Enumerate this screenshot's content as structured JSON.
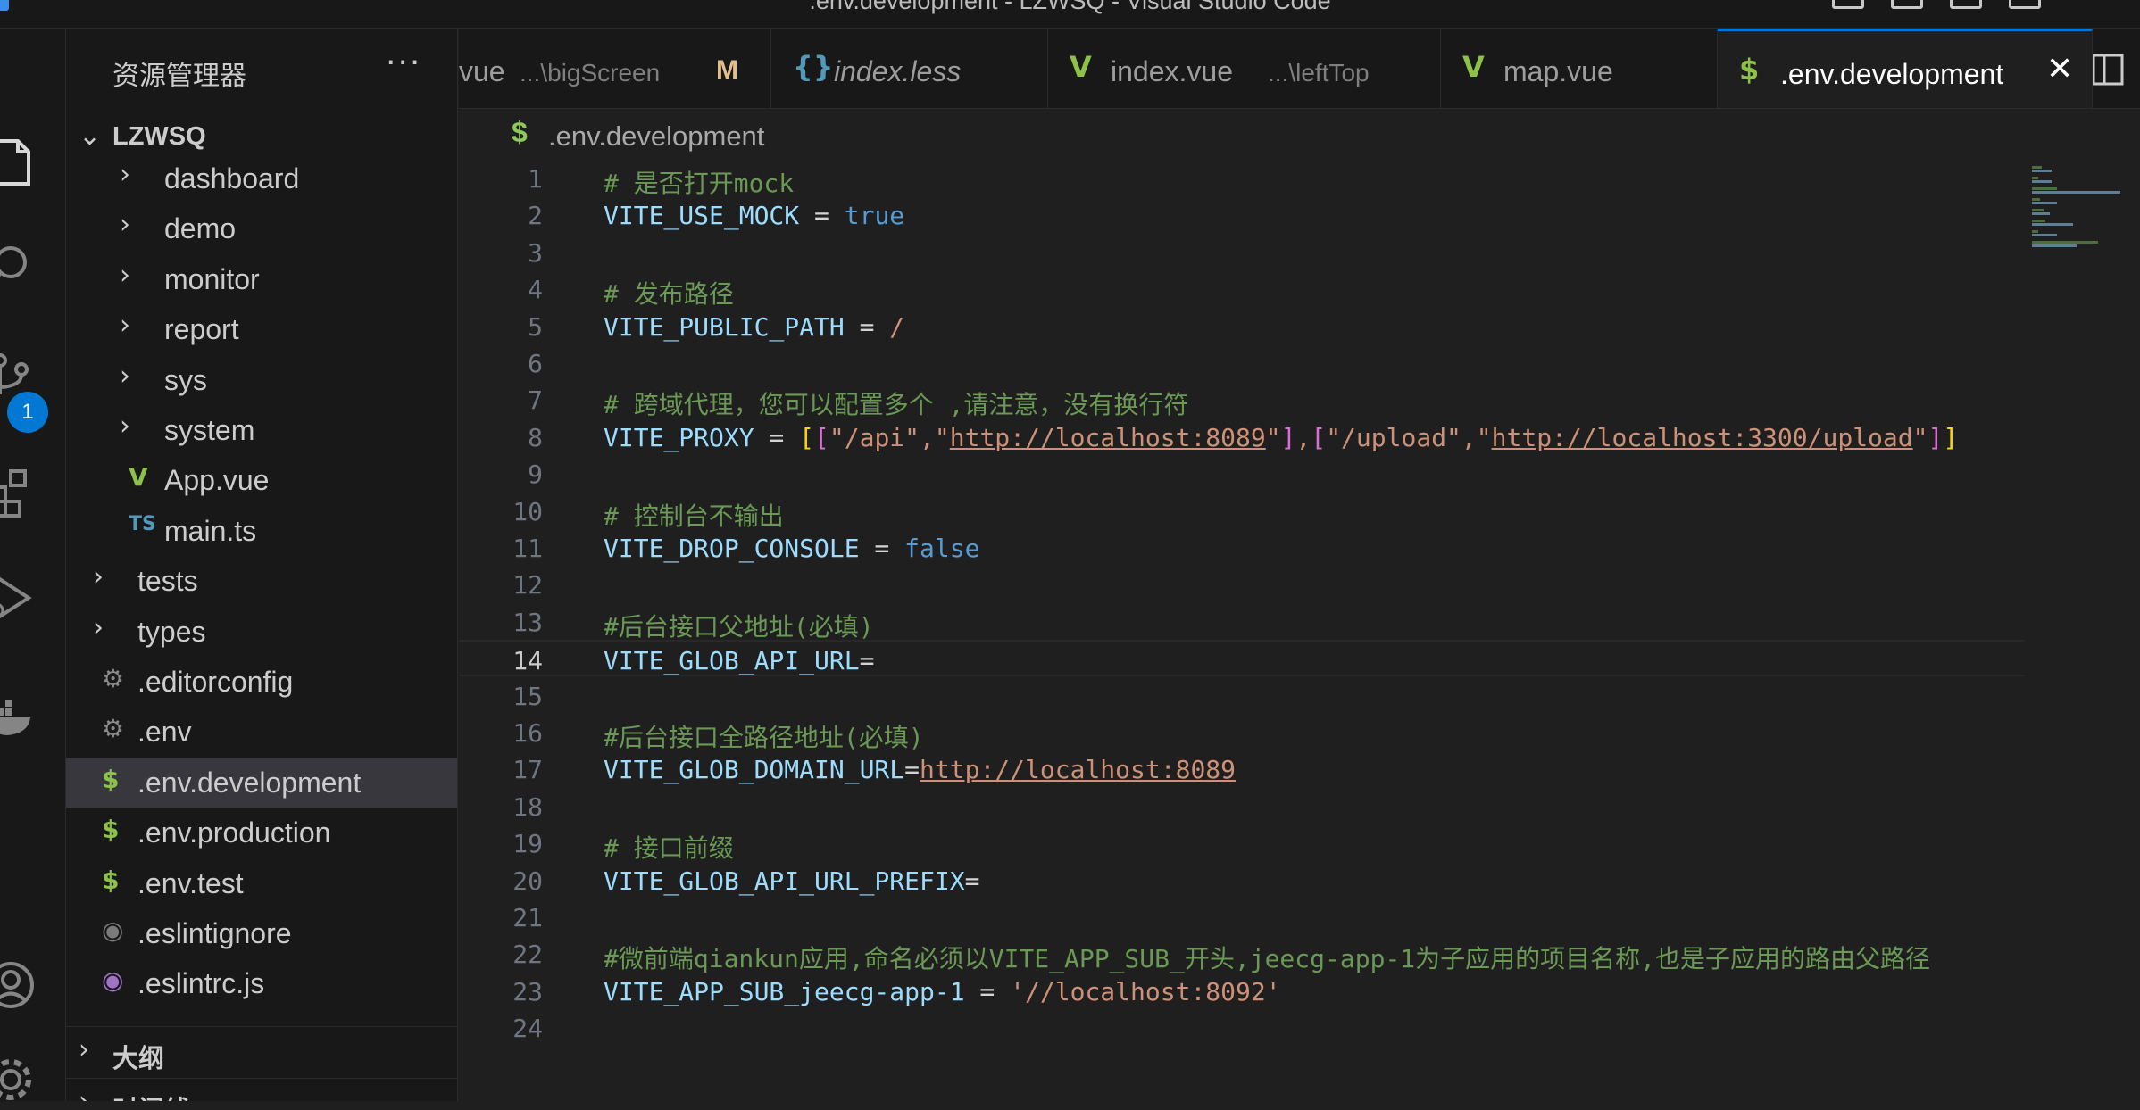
{
  "window": {
    "title": ".env.development - LZWSQ - Visual Studio Code"
  },
  "activity_bar": {
    "scm_badge": "1"
  },
  "sidebar": {
    "title": "资源管理器",
    "more": "···",
    "root": "LZWSQ",
    "items": [
      {
        "label": "dashboard",
        "type": "folder",
        "depth": 2
      },
      {
        "label": "demo",
        "type": "folder",
        "depth": 2
      },
      {
        "label": "monitor",
        "type": "folder",
        "depth": 2
      },
      {
        "label": "report",
        "type": "folder",
        "depth": 2
      },
      {
        "label": "sys",
        "type": "folder",
        "depth": 2
      },
      {
        "label": "system",
        "type": "folder",
        "depth": 2
      },
      {
        "label": "App.vue",
        "type": "vue",
        "depth": 2
      },
      {
        "label": "main.ts",
        "type": "ts",
        "depth": 2
      },
      {
        "label": "tests",
        "type": "folder",
        "depth": 1
      },
      {
        "label": "types",
        "type": "folder",
        "depth": 1
      },
      {
        "label": ".editorconfig",
        "type": "gear",
        "depth": 1
      },
      {
        "label": ".env",
        "type": "gear",
        "depth": 1
      },
      {
        "label": ".env.development",
        "type": "dollar",
        "depth": 1,
        "selected": true
      },
      {
        "label": ".env.production",
        "type": "dollar",
        "depth": 1
      },
      {
        "label": ".env.test",
        "type": "dollar",
        "depth": 1
      },
      {
        "label": ".eslintignore",
        "type": "eslint-gray",
        "depth": 1
      },
      {
        "label": ".eslintrc.js",
        "type": "eslint",
        "depth": 1
      }
    ],
    "icon_glyphs": {
      "ts": "TS",
      "dollar": "$",
      "gear": "⚙",
      "vue": "V",
      "eslint": "◉",
      "eslint-gray": "◉"
    },
    "sections": [
      {
        "label": "大纲"
      },
      {
        "label": "时间线"
      }
    ]
  },
  "tabs": [
    {
      "name": "vue",
      "path": "...\\bigScreen",
      "modified": "M",
      "icon": "",
      "icon_color": ""
    },
    {
      "name": "index.less",
      "path": "",
      "modified": "",
      "icon": "{}",
      "icon_color": "#519aba"
    },
    {
      "name": "index.vue",
      "path": "...\\leftTop",
      "modified": "",
      "icon": "V",
      "icon_color": "#8dc149"
    },
    {
      "name": "map.vue",
      "path": "",
      "modified": "",
      "icon": "V",
      "icon_color": "#8dc149"
    },
    {
      "name": ".env.development",
      "path": "",
      "modified": "",
      "icon": "$",
      "icon_color": "#8dc149",
      "active": true,
      "close": "✕"
    }
  ],
  "breadcrumb": {
    "icon": "$",
    "file": ".env.development"
  },
  "editor": {
    "current_line": 14,
    "lines": [
      {
        "n": "1",
        "tokens": [
          {
            "t": "# 是否打开mock",
            "c": "com"
          }
        ]
      },
      {
        "n": "2",
        "tokens": [
          {
            "t": "VITE_USE_MOCK",
            "c": "var"
          },
          {
            "t": " = ",
            "c": "op"
          },
          {
            "t": "true",
            "c": "key"
          }
        ]
      },
      {
        "n": "3",
        "tokens": []
      },
      {
        "n": "4",
        "tokens": [
          {
            "t": "# 发布路径",
            "c": "com"
          }
        ]
      },
      {
        "n": "5",
        "tokens": [
          {
            "t": "VITE_PUBLIC_PATH",
            "c": "var"
          },
          {
            "t": " = ",
            "c": "op"
          },
          {
            "t": "/",
            "c": "str"
          }
        ]
      },
      {
        "n": "6",
        "tokens": []
      },
      {
        "n": "7",
        "tokens": [
          {
            "t": "# 跨域代理，您可以配置多个 ,请注意，没有换行符",
            "c": "com"
          }
        ]
      },
      {
        "n": "8",
        "tokens": [
          {
            "t": "VITE_PROXY",
            "c": "var"
          },
          {
            "t": " = ",
            "c": "op"
          },
          {
            "t": "[",
            "c": "br1"
          },
          {
            "t": "[",
            "c": "br2"
          },
          {
            "t": "\"/api\",\"",
            "c": "str"
          },
          {
            "t": "http://localhost:8089",
            "c": "url"
          },
          {
            "t": "\"",
            "c": "str"
          },
          {
            "t": "]",
            "c": "br2"
          },
          {
            "t": ",",
            "c": "str"
          },
          {
            "t": "[",
            "c": "br2"
          },
          {
            "t": "\"/upload\",\"",
            "c": "str"
          },
          {
            "t": "http://localhost:3300/upload",
            "c": "url"
          },
          {
            "t": "\"",
            "c": "str"
          },
          {
            "t": "]",
            "c": "br2"
          },
          {
            "t": "]",
            "c": "br1"
          }
        ]
      },
      {
        "n": "9",
        "tokens": []
      },
      {
        "n": "10",
        "tokens": [
          {
            "t": "# 控制台不输出",
            "c": "com"
          }
        ]
      },
      {
        "n": "11",
        "tokens": [
          {
            "t": "VITE_DROP_CONSOLE",
            "c": "var"
          },
          {
            "t": " = ",
            "c": "op"
          },
          {
            "t": "false",
            "c": "key"
          }
        ]
      },
      {
        "n": "12",
        "tokens": []
      },
      {
        "n": "13",
        "tokens": [
          {
            "t": "#后台接口父地址(必填)",
            "c": "com"
          }
        ]
      },
      {
        "n": "14",
        "tokens": [
          {
            "t": "VITE_GLOB_API_URL",
            "c": "var"
          },
          {
            "t": "=",
            "c": "op"
          }
        ]
      },
      {
        "n": "15",
        "tokens": []
      },
      {
        "n": "16",
        "tokens": [
          {
            "t": "#后台接口全路径地址(必填)",
            "c": "com"
          }
        ]
      },
      {
        "n": "17",
        "tokens": [
          {
            "t": "VITE_GLOB_DOMAIN_URL",
            "c": "var"
          },
          {
            "t": "=",
            "c": "op"
          },
          {
            "t": "http://localhost:8089",
            "c": "url"
          }
        ]
      },
      {
        "n": "18",
        "tokens": []
      },
      {
        "n": "19",
        "tokens": [
          {
            "t": "# 接口前缀",
            "c": "com"
          }
        ]
      },
      {
        "n": "20",
        "tokens": [
          {
            "t": "VITE_GLOB_API_URL_PREFIX",
            "c": "var"
          },
          {
            "t": "=",
            "c": "op"
          }
        ]
      },
      {
        "n": "21",
        "tokens": []
      },
      {
        "n": "22",
        "tokens": [
          {
            "t": "#微前端qiankun应用,命名必须以VITE_APP_SUB_开头,jeecg-app-1为子应用的项目名称,也是子应用的路由父路径",
            "c": "com"
          }
        ]
      },
      {
        "n": "23",
        "tokens": [
          {
            "t": "VITE_APP_SUB_jeecg-app-1",
            "c": "var"
          },
          {
            "t": " = ",
            "c": "op"
          },
          {
            "t": "'//localhost:8092'",
            "c": "str"
          }
        ]
      },
      {
        "n": "24",
        "tokens": []
      }
    ]
  },
  "colors": {
    "accent": "#0078d4",
    "vue": "#8dc149",
    "comment": "#6a9955",
    "variable": "#9cdcfe",
    "keyword": "#569cd6",
    "string": "#ce9178"
  }
}
